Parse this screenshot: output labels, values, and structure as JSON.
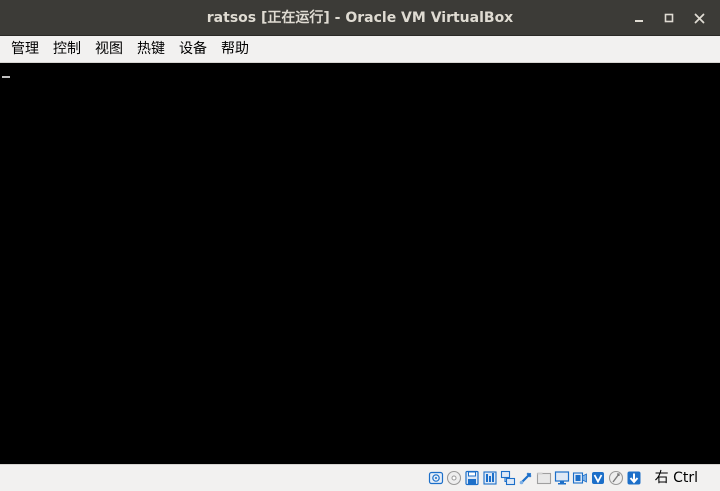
{
  "window": {
    "title": "ratsos [正在运行] - Oracle VM VirtualBox"
  },
  "menubar": {
    "items": [
      {
        "label": "管理"
      },
      {
        "label": "控制"
      },
      {
        "label": "视图"
      },
      {
        "label": "热键"
      },
      {
        "label": "设备"
      },
      {
        "label": "帮助"
      }
    ]
  },
  "statusbar": {
    "icons": [
      "hard-disk-icon",
      "optical-drive-icon",
      "floppy-icon",
      "audio-icon",
      "network-icon",
      "usb-icon",
      "shared-folder-icon",
      "display-icon",
      "video-capture-icon",
      "cpu-icon",
      "mouse-integration-icon",
      "host-key-icon"
    ],
    "host_key": "右 Ctrl"
  },
  "colors": {
    "titlebar": "#3c3b37",
    "title_text": "#dfdbd2",
    "menubar": "#f2f1f0",
    "screen": "#000000",
    "accent_blue": "#1c6fc9"
  }
}
